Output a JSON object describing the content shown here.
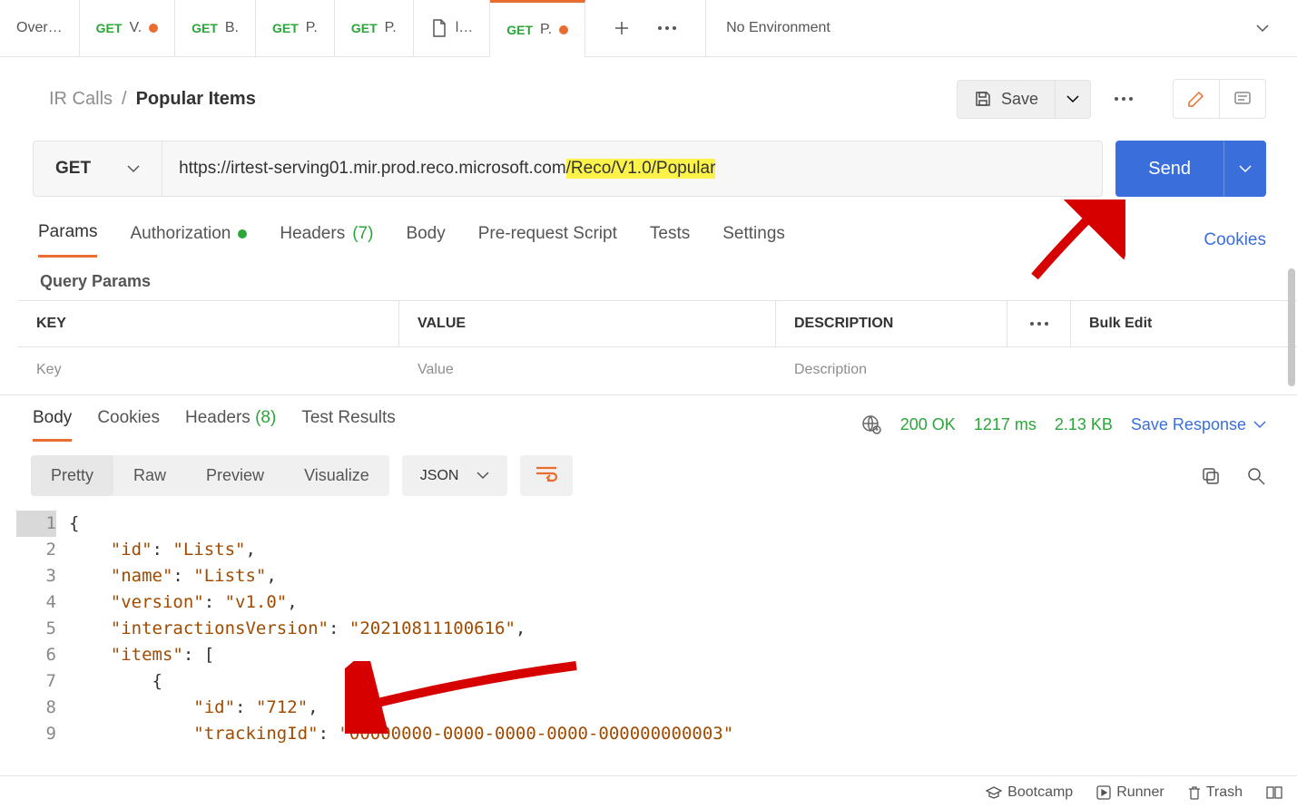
{
  "tabs": [
    {
      "label": "Over…",
      "method": ""
    },
    {
      "label": "V.",
      "method": "GET",
      "dot": true
    },
    {
      "label": "B.",
      "method": "GET"
    },
    {
      "label": "P.",
      "method": "GET"
    },
    {
      "label": "P.",
      "method": "GET"
    },
    {
      "label": "l…",
      "method": "",
      "file": true
    },
    {
      "label": "P.",
      "method": "GET",
      "dot": true,
      "active": true
    }
  ],
  "environment": "No Environment",
  "breadcrumb": {
    "parent": "IR Calls",
    "sep": "/",
    "current": "Popular Items"
  },
  "save_label": "Save",
  "request": {
    "method": "GET",
    "url_plain": "https://irtest-serving01.mir.prod.reco.microsoft.com",
    "url_highlight": "/Reco/V1.0/Popular",
    "send_label": "Send"
  },
  "req_tabs": {
    "params": "Params",
    "authorization": "Authorization",
    "headers": "Headers",
    "headers_count": "(7)",
    "body": "Body",
    "prerequest": "Pre-request Script",
    "tests": "Tests",
    "settings": "Settings",
    "cookies": "Cookies"
  },
  "query_params": {
    "title": "Query Params",
    "col_key": "KEY",
    "col_value": "VALUE",
    "col_description": "DESCRIPTION",
    "bulk_edit": "Bulk Edit",
    "ph_key": "Key",
    "ph_value": "Value",
    "ph_description": "Description"
  },
  "resp_tabs": {
    "body": "Body",
    "cookies": "Cookies",
    "headers": "Headers",
    "headers_count": "(8)",
    "tests": "Test Results"
  },
  "resp_meta": {
    "status": "200 OK",
    "time": "1217 ms",
    "size": "2.13 KB",
    "save_response": "Save Response"
  },
  "view": {
    "pretty": "Pretty",
    "raw": "Raw",
    "preview": "Preview",
    "visualize": "Visualize",
    "format": "JSON"
  },
  "json_lines": [
    "{",
    "    \"id\": \"Lists\",",
    "    \"name\": \"Lists\",",
    "    \"version\": \"v1.0\",",
    "    \"interactionsVersion\": \"20210811100616\",",
    "    \"items\": [",
    "        {",
    "            \"id\": \"712\",",
    "            \"trackingId\": \"00000000-0000-0000-0000-000000000003\""
  ],
  "footer": {
    "bootcamp": "Bootcamp",
    "runner": "Runner",
    "trash": "Trash"
  }
}
